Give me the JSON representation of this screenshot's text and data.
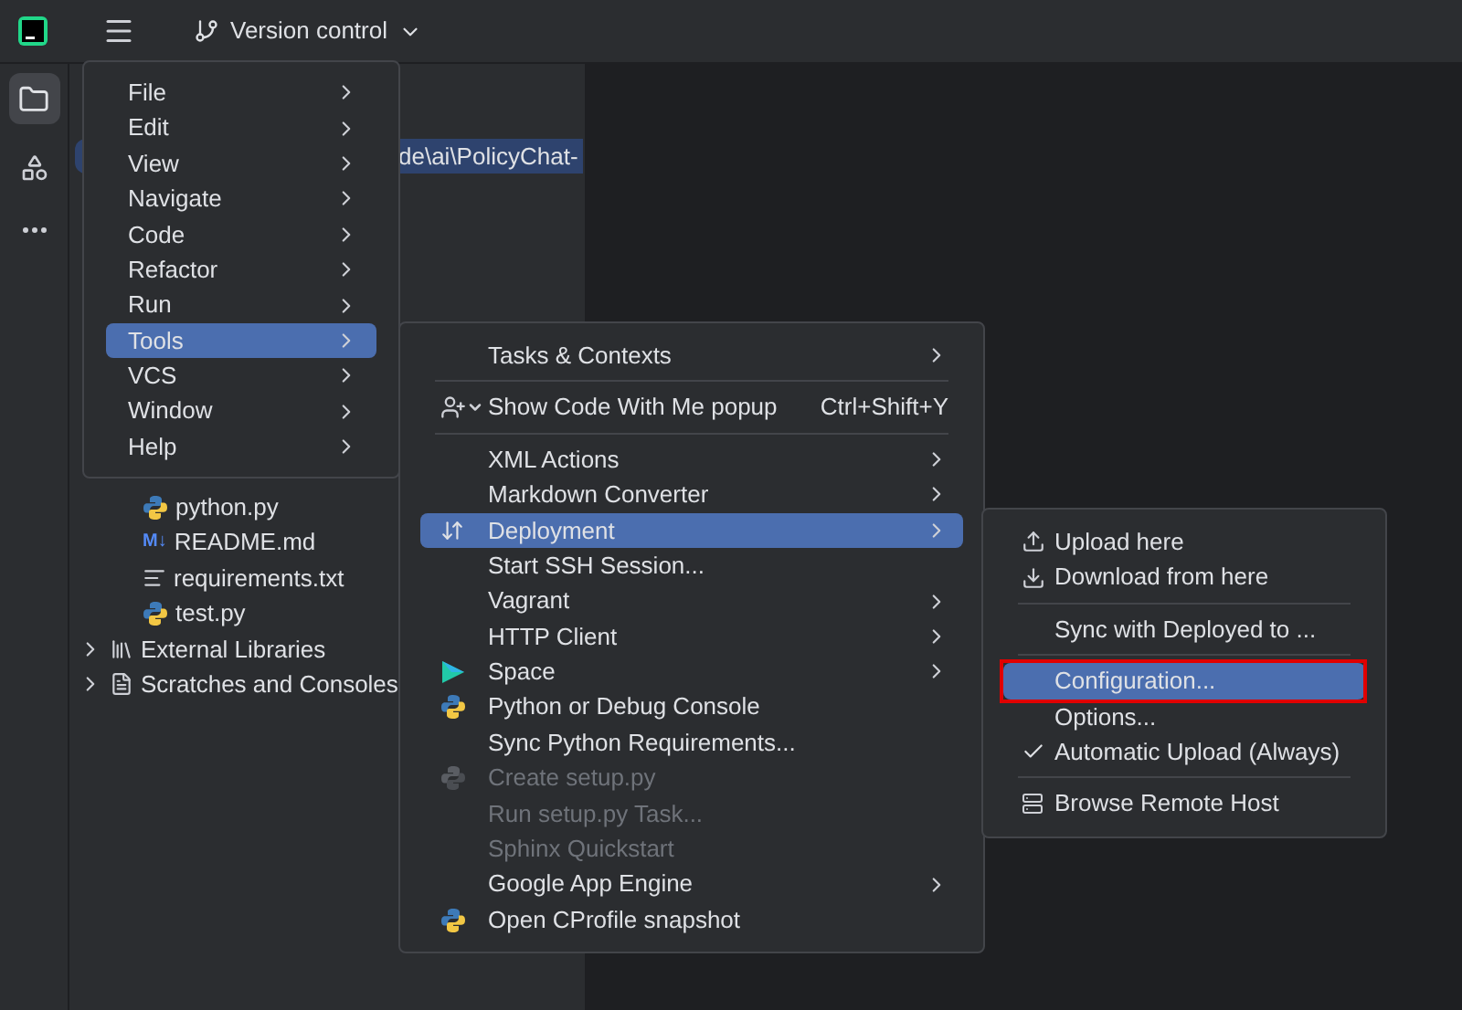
{
  "toolbar": {
    "project_menu": "Version control"
  },
  "tree": {
    "path_row": {
      "text": "de\\ai\\PolicyChat-",
      "selected": true
    },
    "items": [
      {
        "label": "python.py",
        "kind": "python"
      },
      {
        "label": "README.md",
        "kind": "markdown",
        "badge": "M↓"
      },
      {
        "label": "requirements.txt",
        "kind": "text"
      },
      {
        "label": "test.py",
        "kind": "python"
      },
      {
        "label": "External Libraries",
        "kind": "libraries",
        "expanded": false
      },
      {
        "label": "Scratches and Consoles",
        "kind": "scratches",
        "expanded": false
      }
    ]
  },
  "main_menu": [
    {
      "label": "File",
      "submenu": true,
      "selected": false
    },
    {
      "label": "Edit",
      "submenu": true,
      "selected": false
    },
    {
      "label": "View",
      "submenu": true,
      "selected": false
    },
    {
      "label": "Navigate",
      "submenu": true,
      "selected": false
    },
    {
      "label": "Code",
      "submenu": true,
      "selected": false
    },
    {
      "label": "Refactor",
      "submenu": true,
      "selected": false
    },
    {
      "label": "Run",
      "submenu": true,
      "selected": false
    },
    {
      "label": "Tools",
      "submenu": true,
      "selected": true
    },
    {
      "label": "VCS",
      "submenu": true,
      "selected": false
    },
    {
      "label": "Window",
      "submenu": true,
      "selected": false
    },
    {
      "label": "Help",
      "submenu": true,
      "selected": false
    }
  ],
  "tools_menu": [
    {
      "kind": "item",
      "label": "Tasks & Contexts",
      "submenu": true,
      "selected": false,
      "disabled": false
    },
    {
      "kind": "separator"
    },
    {
      "kind": "item",
      "label": "Show Code With Me popup",
      "shortcut": "Ctrl+Shift+Y",
      "submenu": false,
      "selected": false,
      "disabled": false
    },
    {
      "kind": "separator"
    },
    {
      "kind": "item",
      "label": "XML Actions",
      "submenu": true,
      "selected": false,
      "disabled": false
    },
    {
      "kind": "item",
      "label": "Markdown Converter",
      "submenu": true,
      "selected": false,
      "disabled": false
    },
    {
      "kind": "item",
      "label": "Deployment",
      "submenu": true,
      "selected": true,
      "disabled": false
    },
    {
      "kind": "item",
      "label": "Start SSH Session...",
      "submenu": false,
      "selected": false,
      "disabled": false
    },
    {
      "kind": "item",
      "label": "Vagrant",
      "submenu": true,
      "selected": false,
      "disabled": false
    },
    {
      "kind": "item",
      "label": "HTTP Client",
      "submenu": true,
      "selected": false,
      "disabled": false
    },
    {
      "kind": "item",
      "label": "Space",
      "submenu": true,
      "selected": false,
      "disabled": false
    },
    {
      "kind": "item",
      "label": "Python or Debug Console",
      "submenu": false,
      "selected": false,
      "disabled": false
    },
    {
      "kind": "item",
      "label": "Sync Python Requirements...",
      "submenu": false,
      "selected": false,
      "disabled": false
    },
    {
      "kind": "item",
      "label": "Create setup.py",
      "submenu": false,
      "selected": false,
      "disabled": true
    },
    {
      "kind": "item",
      "label": "Run setup.py Task...",
      "submenu": false,
      "selected": false,
      "disabled": true
    },
    {
      "kind": "item",
      "label": "Sphinx Quickstart",
      "submenu": false,
      "selected": false,
      "disabled": true
    },
    {
      "kind": "item",
      "label": "Google App Engine",
      "submenu": true,
      "selected": false,
      "disabled": false
    },
    {
      "kind": "item",
      "label": "Open CProfile snapshot",
      "submenu": false,
      "selected": false,
      "disabled": false
    }
  ],
  "deployment_menu": [
    {
      "kind": "item",
      "label": "Upload here",
      "selected": false,
      "checked": false,
      "annotated": false
    },
    {
      "kind": "item",
      "label": "Download from here",
      "selected": false,
      "checked": false,
      "annotated": false
    },
    {
      "kind": "separator"
    },
    {
      "kind": "item",
      "label": "Sync with Deployed to ...",
      "selected": false,
      "checked": false,
      "annotated": false
    },
    {
      "kind": "separator"
    },
    {
      "kind": "item",
      "label": "Configuration...",
      "selected": true,
      "checked": false,
      "annotated": true
    },
    {
      "kind": "item",
      "label": "Options...",
      "selected": false,
      "checked": false,
      "annotated": false
    },
    {
      "kind": "item",
      "label": "Automatic Upload (Always)",
      "selected": false,
      "checked": true,
      "annotated": false
    },
    {
      "kind": "separator"
    },
    {
      "kind": "item",
      "label": "Browse Remote Host",
      "selected": false,
      "checked": false,
      "annotated": false
    }
  ]
}
